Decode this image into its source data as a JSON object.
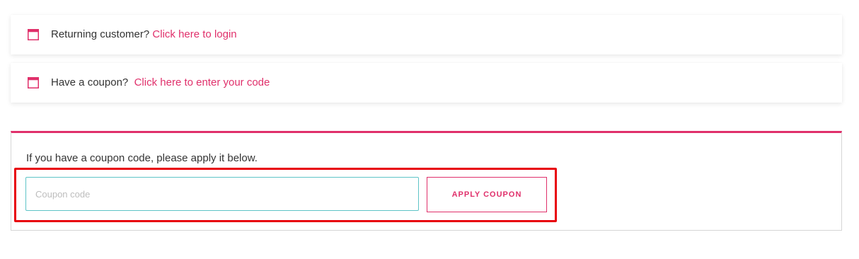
{
  "notices": {
    "login": {
      "text": "Returning customer?",
      "link": "Click here to login",
      "icon": "window-icon"
    },
    "coupon": {
      "text": "Have a coupon?",
      "link": "Click here to enter your code",
      "icon": "window-icon"
    }
  },
  "coupon_form": {
    "intro": "If you have a coupon code, please apply it below.",
    "input_value": "",
    "input_placeholder": "Coupon code",
    "apply_label": "APPLY COUPON"
  },
  "colors": {
    "accent": "#e0306b",
    "input_border": "#5ec4c7",
    "highlight": "#e8000b"
  }
}
